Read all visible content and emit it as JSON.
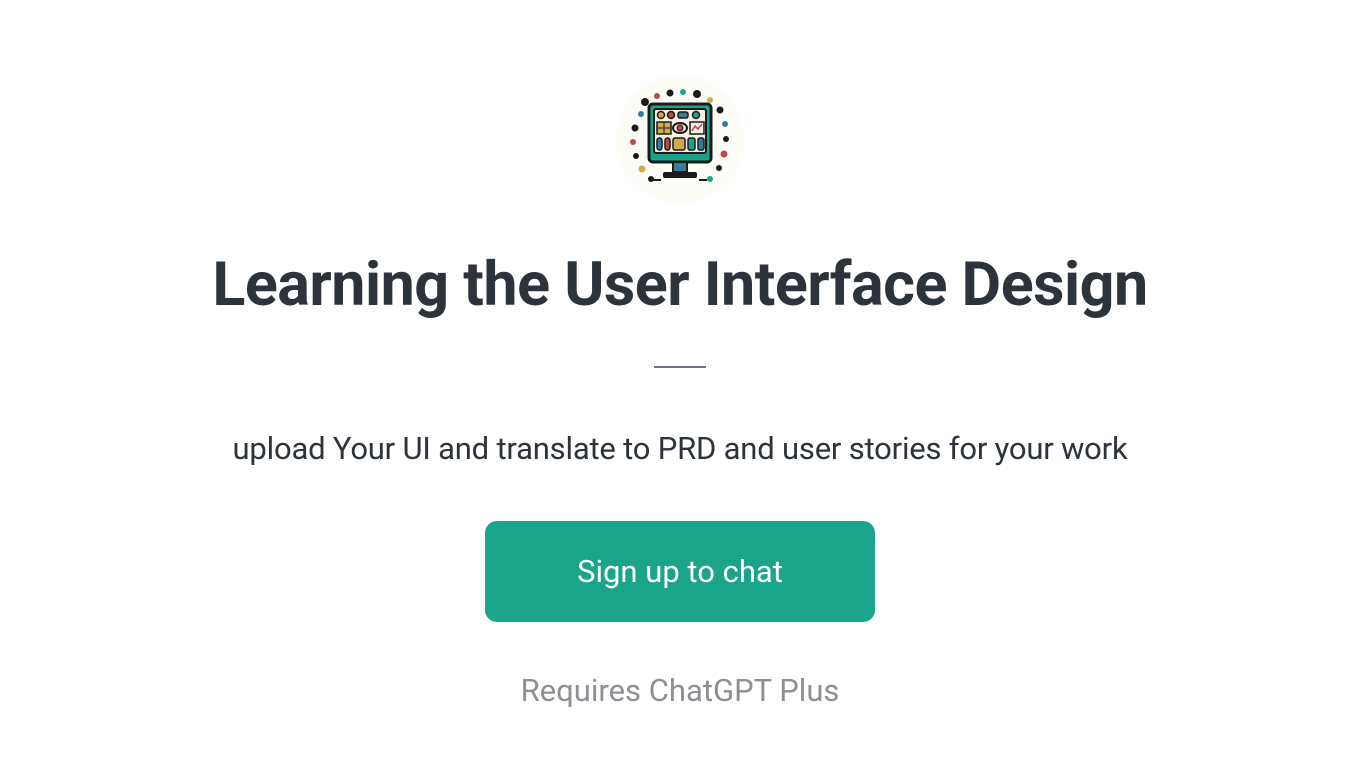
{
  "header": {
    "title": "Learning the User Interface Design",
    "subtitle": "upload Your UI and translate to PRD and user stories for your work"
  },
  "cta": {
    "label": "Sign up to chat"
  },
  "footer": {
    "note": "Requires ChatGPT Plus"
  },
  "icon": {
    "name": "app-logo-icon"
  }
}
